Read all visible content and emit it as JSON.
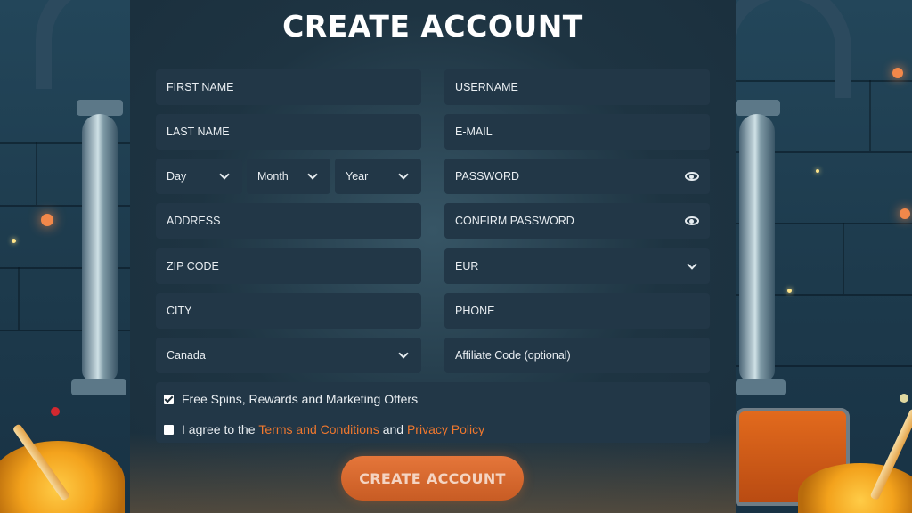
{
  "title": "CREATE ACCOUNT",
  "left_column": {
    "first_name": "FIRST NAME",
    "last_name": "LAST NAME",
    "dob": {
      "day": "Day",
      "month": "Month",
      "year": "Year"
    },
    "address": "ADDRESS",
    "zip_code": "ZIP CODE",
    "city": "CITY",
    "country": "Canada"
  },
  "right_column": {
    "username": "USERNAME",
    "email": "E-MAIL",
    "password": "PASSWORD",
    "confirm_password": "CONFIRM PASSWORD",
    "currency": "EUR",
    "phone": "PHONE",
    "affiliate_code": "Affiliate Code (optional)"
  },
  "consent": {
    "marketing": {
      "label": "Free Spins, Rewards and Marketing Offers",
      "checked": true
    },
    "terms": {
      "checked": false,
      "prefix": "I agree to the",
      "terms_link": "Terms and Conditions",
      "middle": "and",
      "privacy_link": "Privacy Policy"
    }
  },
  "submit_label": "CREATE ACCOUNT",
  "colors": {
    "accent": "#f0782e",
    "field_bg": "#223747",
    "button": "#d8682e"
  },
  "icons": {
    "password_toggle": "eye-icon",
    "dropdown": "chevron-down-icon",
    "checkbox": "checkbox-icon"
  }
}
